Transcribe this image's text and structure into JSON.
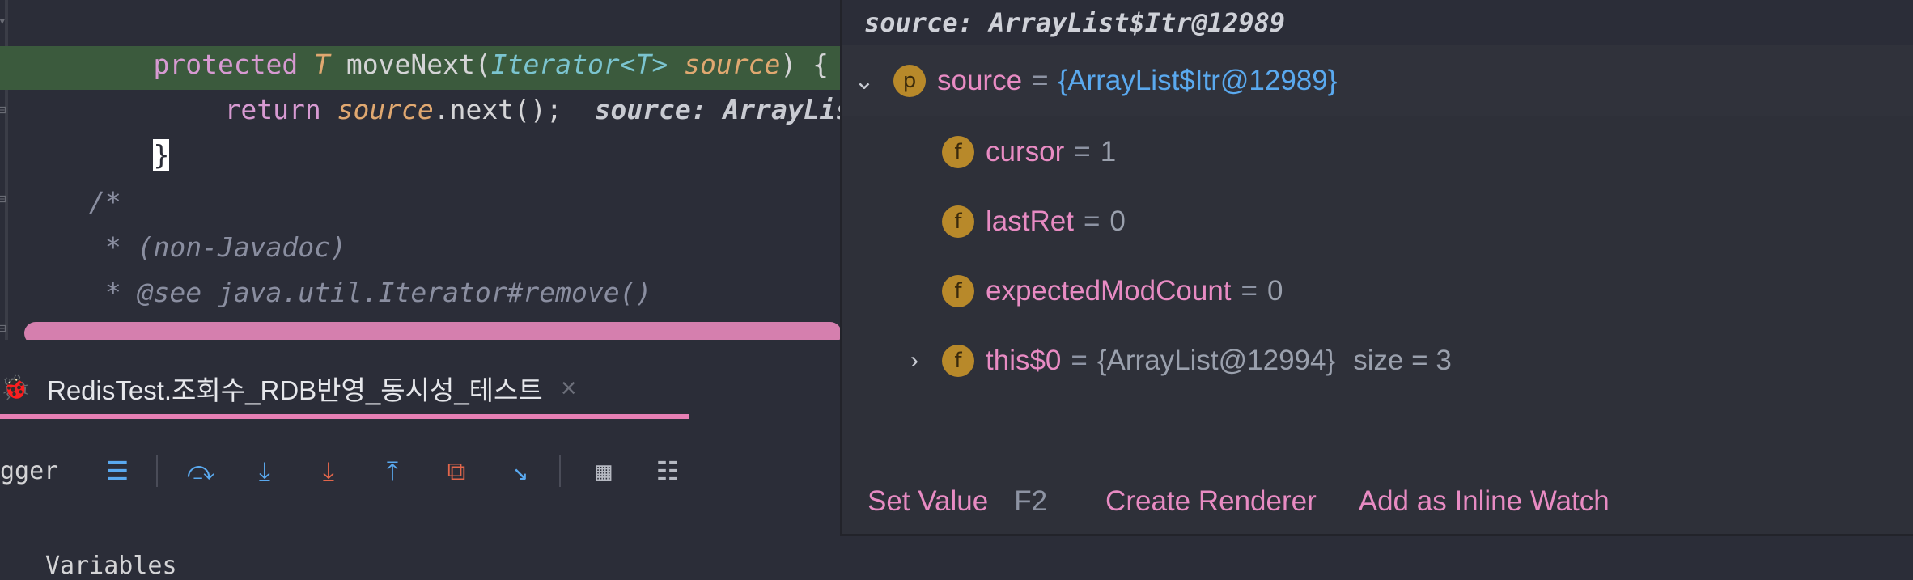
{
  "editor": {
    "line1": {
      "kw": "protected",
      "type_param": "T",
      "method": "moveNext(",
      "type": "Iterator<T>",
      "param": "source",
      "close": ") {"
    },
    "line2": {
      "kw": "return",
      "param": "source",
      "call": ".next();",
      "hint": "source: ArrayLis"
    },
    "line3": "}",
    "line4": "/*",
    "line5": " * (non-Javadoc)",
    "line6": " * @see java.util.Iterator#remove()"
  },
  "debug_tab": {
    "label": "RedisTest.조회수_RDB반영_동시성_테스트",
    "close": "×"
  },
  "toolbar": {
    "label": "gger",
    "buttons": [
      {
        "name": "frames-icon",
        "glyph": "☰",
        "color": "blue"
      },
      {
        "name": "step-over-icon",
        "glyph": "⤼",
        "color": "blue"
      },
      {
        "name": "step-into-icon",
        "glyph": "⤓",
        "color": "blue"
      },
      {
        "name": "force-step-into-icon",
        "glyph": "⤓",
        "color": "red"
      },
      {
        "name": "step-out-icon",
        "glyph": "⤒",
        "color": "blue"
      },
      {
        "name": "drop-frame-icon",
        "glyph": "⧉",
        "color": "red"
      },
      {
        "name": "run-to-cursor-icon",
        "glyph": "↘",
        "color": "blue"
      },
      {
        "name": "evaluate-icon",
        "glyph": "▦",
        "color": "grey"
      },
      {
        "name": "trace-icon",
        "glyph": "☷",
        "color": "grey"
      }
    ]
  },
  "bottom_text": "Variables",
  "popup": {
    "title": "source: ArrayList$Itr@12989",
    "root": {
      "badge": "p",
      "name": "source",
      "eq": "=",
      "value": "{ArrayList$Itr@12989}"
    },
    "fields": [
      {
        "badge": "f",
        "name": "cursor",
        "eq": "=",
        "value": "1"
      },
      {
        "badge": "f",
        "name": "lastRet",
        "eq": "=",
        "value": "0"
      },
      {
        "badge": "f",
        "name": "expectedModCount",
        "eq": "=",
        "value": "0"
      }
    ],
    "outer": {
      "badge": "f",
      "name": "this$0",
      "eq": "=",
      "value": "{ArrayList@12994}",
      "extra": "size = 3"
    },
    "actions": {
      "set_value": "Set Value",
      "set_value_key": "F2",
      "create_renderer": "Create Renderer",
      "add_watch": "Add as Inline Watch"
    }
  },
  "colors": {
    "accent_pink": "#e77fb4",
    "field_name": "#e88bc3",
    "value_blue": "#5aa9ef",
    "badge": "#b8892a"
  }
}
